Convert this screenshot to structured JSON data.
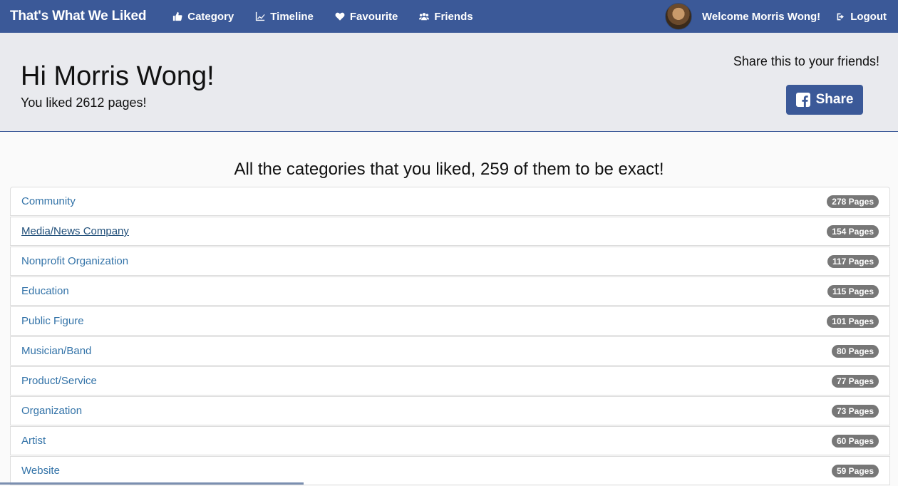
{
  "navbar": {
    "brand": "That's What We Liked",
    "items": [
      {
        "label": "Category",
        "icon": "thumbs-up-icon"
      },
      {
        "label": "Timeline",
        "icon": "line-chart-icon"
      },
      {
        "label": "Favourite",
        "icon": "heart-icon"
      },
      {
        "label": "Friends",
        "icon": "users-icon"
      }
    ],
    "welcome": "Welcome Morris Wong!",
    "logout": "Logout"
  },
  "header": {
    "greeting": "Hi Morris Wong!",
    "liked_text": "You liked 2612 pages!",
    "share_prompt": "Share this to your friends!",
    "share_label": "Share"
  },
  "categories": {
    "heading": "All the categories that you liked, 259 of them to be exact!",
    "items": [
      {
        "name": "Community",
        "count": "278 Pages"
      },
      {
        "name": "Media/News Company",
        "count": "154 Pages"
      },
      {
        "name": "Nonprofit Organization",
        "count": "117 Pages"
      },
      {
        "name": "Education",
        "count": "115 Pages"
      },
      {
        "name": "Public Figure",
        "count": "101 Pages"
      },
      {
        "name": "Musician/Band",
        "count": "80 Pages"
      },
      {
        "name": "Product/Service",
        "count": "77 Pages"
      },
      {
        "name": "Organization",
        "count": "73 Pages"
      },
      {
        "name": "Artist",
        "count": "60 Pages"
      },
      {
        "name": "Website",
        "count": "59 Pages"
      }
    ]
  },
  "colors": {
    "brand": "#3b5998",
    "link": "#3373a8",
    "badge": "#777777",
    "jumbotron": "#e9eaee"
  }
}
